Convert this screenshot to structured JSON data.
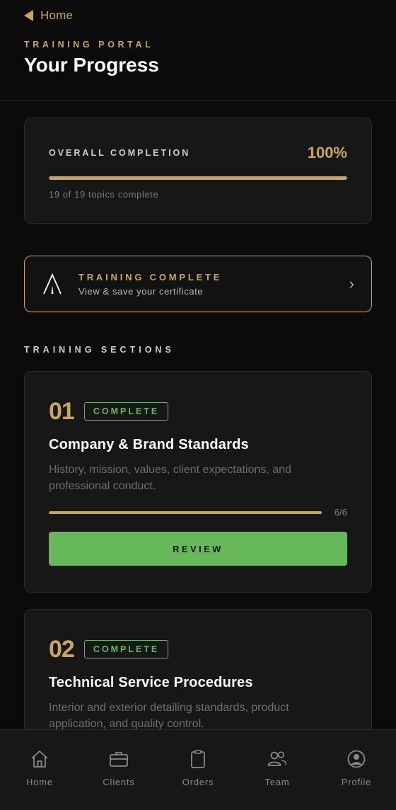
{
  "header": {
    "back_label": "Home",
    "eyebrow": "TRAINING PORTAL",
    "title": "Your Progress"
  },
  "overall": {
    "label": "OVERALL COMPLETION",
    "percent_text": "100%",
    "progress": 1.0,
    "subtext": "19 of 19 topics complete"
  },
  "banner": {
    "title": "TRAINING COMPLETE",
    "subtitle": "View & save your certificate",
    "chevron": "›"
  },
  "sections_heading": "TRAINING SECTIONS",
  "sections": [
    {
      "number": "01",
      "badge": "COMPLETE",
      "title": "Company & Brand Standards",
      "description": "History, mission, values, client expectations, and professional conduct.",
      "progress": 1.0,
      "count": "6/6",
      "button": "REVIEW"
    },
    {
      "number": "02",
      "badge": "COMPLETE",
      "title": "Technical Service Procedures",
      "description": "Interior and exterior detailing standards, product application, and quality control."
    }
  ],
  "nav": [
    {
      "label": "Home",
      "icon": "home-icon"
    },
    {
      "label": "Clients",
      "icon": "briefcase-icon"
    },
    {
      "label": "Orders",
      "icon": "clipboard-icon"
    },
    {
      "label": "Team",
      "icon": "team-icon"
    },
    {
      "label": "Profile",
      "icon": "profile-icon"
    }
  ],
  "colors": {
    "accent_gold": "#c9a75a",
    "success_green": "#66b85a",
    "background": "#0b0b0b",
    "card": "#171717"
  }
}
